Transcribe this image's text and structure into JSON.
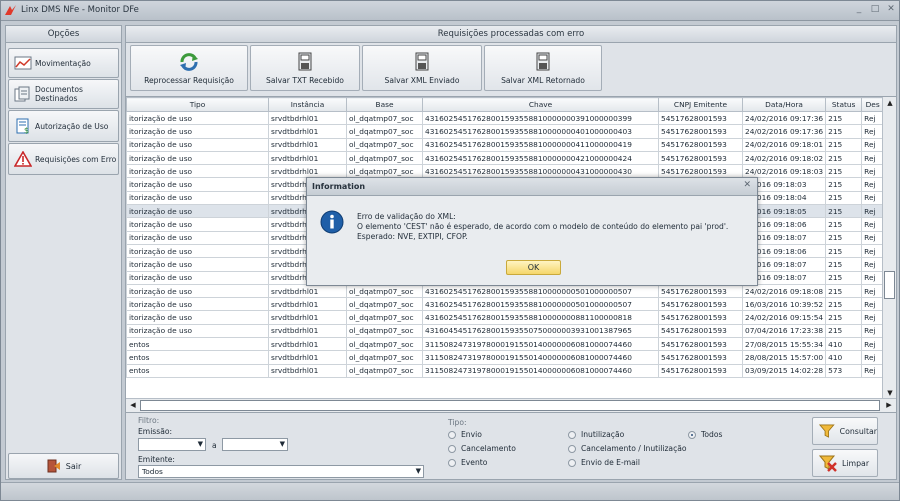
{
  "window": {
    "title": "Linx DMS NFe - Monitor DFe",
    "minimize": "_",
    "maximize": "□",
    "close": "✕"
  },
  "sidebar": {
    "header": "Opções",
    "items": [
      {
        "label": "Movimentação",
        "icon": "line-chart-icon"
      },
      {
        "label": "Documentos Destinados",
        "icon": "documents-icon"
      },
      {
        "label": "Autorização de Uso",
        "icon": "document-dollar-icon"
      },
      {
        "label": "Requisições com Erro",
        "icon": "warning-icon"
      }
    ],
    "exit_label": "Sair"
  },
  "main": {
    "header": "Requisições processadas com erro",
    "toolbar": [
      {
        "label": "Reprocessar Requisição",
        "icon": "refresh-icon"
      },
      {
        "label": "Salvar TXT Recebido",
        "icon": "save-txt-icon"
      },
      {
        "label": "Salvar XML Enviado",
        "icon": "save-xml-icon"
      },
      {
        "label": "Salvar XML Retornado",
        "icon": "save-xml-icon"
      }
    ]
  },
  "grid": {
    "columns": [
      "Tipo",
      "Instância",
      "Base",
      "Chave",
      "CNPJ Emitente",
      "Data/Hora",
      "Status",
      "Des"
    ],
    "rows": [
      [
        "itorização de uso",
        "srvdtbdrhl01",
        "ol_dqatmp07_soc",
        "43160254517628001593558810000000391000000399",
        "54517628001593",
        "24/02/2016 09:17:36",
        "215",
        "Rej"
      ],
      [
        "itorização de uso",
        "srvdtbdrhl01",
        "ol_dqatmp07_soc",
        "43160254517628001593558810000000401000000403",
        "54517628001593",
        "24/02/2016 09:17:36",
        "215",
        "Rej"
      ],
      [
        "itorização de uso",
        "srvdtbdrhl01",
        "ol_dqatmp07_soc",
        "43160254517628001593558810000000411000000419",
        "54517628001593",
        "24/02/2016 09:18:01",
        "215",
        "Rej"
      ],
      [
        "itorização de uso",
        "srvdtbdrhl01",
        "ol_dqatmp07_soc",
        "43160254517628001593558810000000421000000424",
        "54517628001593",
        "24/02/2016 09:18:02",
        "215",
        "Rej"
      ],
      [
        "itorização de uso",
        "srvdtbdrhl01",
        "ol_dqatmp07_soc",
        "43160254517628001593558810000000431000000430",
        "54517628001593",
        "24/02/2016 09:18:03",
        "215",
        "Rej"
      ],
      [
        "itorização de uso",
        "srvdtbdrhl01",
        "",
        "",
        "",
        "2/2016 09:18:03",
        "215",
        "Rej"
      ],
      [
        "itorização de uso",
        "srvdtbdrhl01",
        "",
        "",
        "",
        "2/2016 09:18:04",
        "215",
        "Rej"
      ],
      [
        "itorização de uso",
        "srvdtbdrhl01",
        "",
        "",
        "",
        "2/2016 09:18:05",
        "215",
        "Rej"
      ],
      [
        "itorização de uso",
        "srvdtbdrhl01",
        "",
        "",
        "",
        "2/2016 09:18:06",
        "215",
        "Rej"
      ],
      [
        "itorização de uso",
        "srvdtbdrhl01",
        "",
        "",
        "",
        "2/2016 09:18:07",
        "215",
        "Rej"
      ],
      [
        "itorização de uso",
        "srvdtbdrhl01",
        "",
        "",
        "",
        "2/2016 09:18:06",
        "215",
        "Rej"
      ],
      [
        "itorização de uso",
        "srvdtbdrhl01",
        "",
        "",
        "",
        "2/2016 09:18:07",
        "215",
        "Rej"
      ],
      [
        "itorização de uso",
        "srvdtbdrhl01",
        "",
        "",
        "",
        "2/2016 09:18:07",
        "215",
        "Rej"
      ],
      [
        "itorização de uso",
        "srvdtbdrhl01",
        "ol_dqatmp07_soc",
        "43160254517628001593558810000000501000000507",
        "54517628001593",
        "24/02/2016 09:18:08",
        "215",
        "Rej"
      ],
      [
        "itorização de uso",
        "srvdtbdrhl01",
        "ol_dqatmp07_soc",
        "43160254517628001593558810000000501000000507",
        "54517628001593",
        "16/03/2016 10:39:52",
        "215",
        "Rej"
      ],
      [
        "itorização de uso",
        "srvdtbdrhl01",
        "ol_dqatmp07_soc",
        "43160254517628001593558810000000881100000818",
        "54517628001593",
        "24/02/2016 09:15:54",
        "215",
        "Rej"
      ],
      [
        "itorização de uso",
        "srvdtbdrhl01",
        "ol_dqatmp07_soc",
        "43160454517628001593550750000003931001387965",
        "54517628001593",
        "07/04/2016 17:23:38",
        "215",
        "Rej"
      ],
      [
        "entos",
        "srvdtbdrhl01",
        "ol_dqatmp07_soc",
        "31150824731978000191550140000006081000074460",
        "54517628001593",
        "27/08/2015 15:55:34",
        "410",
        "Rej"
      ],
      [
        "entos",
        "srvdtbdrhl01",
        "ol_dqatmp07_soc",
        "31150824731978000191550140000006081000074460",
        "54517628001593",
        "28/08/2015 15:57:00",
        "410",
        "Rej"
      ],
      [
        "entos",
        "srvdtbdrhl01",
        "ol_dqatmp07_soc",
        "31150824731978000191550140000006081000074460",
        "54517628001593",
        "03/09/2015 14:02:28",
        "573",
        "Rej"
      ]
    ]
  },
  "filter": {
    "title": "Filtro:",
    "emissao_label": "Emissão:",
    "between_label": "a",
    "emitente_label": "Emitente:",
    "emitente_value": "Todos",
    "tipo_label": "Tipo:",
    "tipo_options": [
      "Envio",
      "Inutilização",
      "Todos",
      "Cancelamento",
      "Cancelamento / Inutilização",
      "Evento",
      "Envio de E-mail"
    ],
    "tipo_selected": "Todos",
    "consultar_label": "Consultar",
    "limpar_label": "Limpar"
  },
  "dialog": {
    "title": "Information",
    "close": "✕",
    "line1": "Erro de validação do XML:",
    "line2": "O elemento 'CEST' não é esperado, de acordo com o modelo de conteúdo do elemento pai 'prod'.",
    "line3": "Esperado: NVE, EXTIPI, CFOP.",
    "ok_label": "OK"
  },
  "colors": {
    "accent": "#c9a93b",
    "info_blue": "#1f5fa8",
    "warning_red": "#c8282a"
  }
}
